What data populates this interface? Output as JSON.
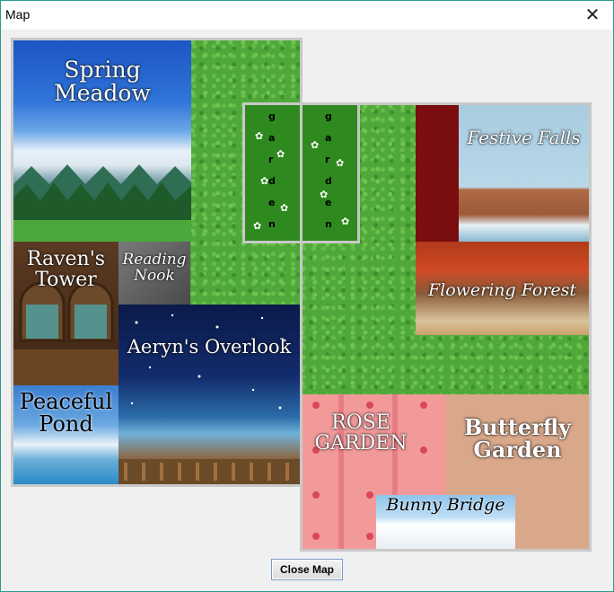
{
  "window": {
    "title": "Map",
    "close_symbol": "✕"
  },
  "regions": {
    "spring_meadow": "Spring\nMeadow",
    "ravens_tower": "Raven's\nTower",
    "reading_nook": "Reading\nNook",
    "peaceful_pond": "Peaceful\nPond",
    "aeryns_overlook": "Aeryn's Overlook",
    "festive_falls": "Festive Falls",
    "flowering_forest": "Flowering Forest",
    "rose_garden": "ROSE\nGARDEN",
    "butterfly_garden": "Butterfly\nGarden",
    "bunny_bridge": "Bunny Bridge",
    "garden_left_letters": [
      "g",
      "a",
      "r",
      "d",
      "e",
      "n"
    ],
    "garden_right_letters": [
      "g",
      "a",
      "r",
      "d",
      "e",
      "n"
    ]
  },
  "buttons": {
    "close_map": "Close Map"
  },
  "colors": {
    "grass": "#4fa83a",
    "sky_blue": "#1f62c8",
    "night": "#0a1640",
    "rose": "#f29a9a",
    "sand": "#d9a88a",
    "dark_red": "#7a0d0d"
  },
  "icons": [
    "close-icon"
  ]
}
